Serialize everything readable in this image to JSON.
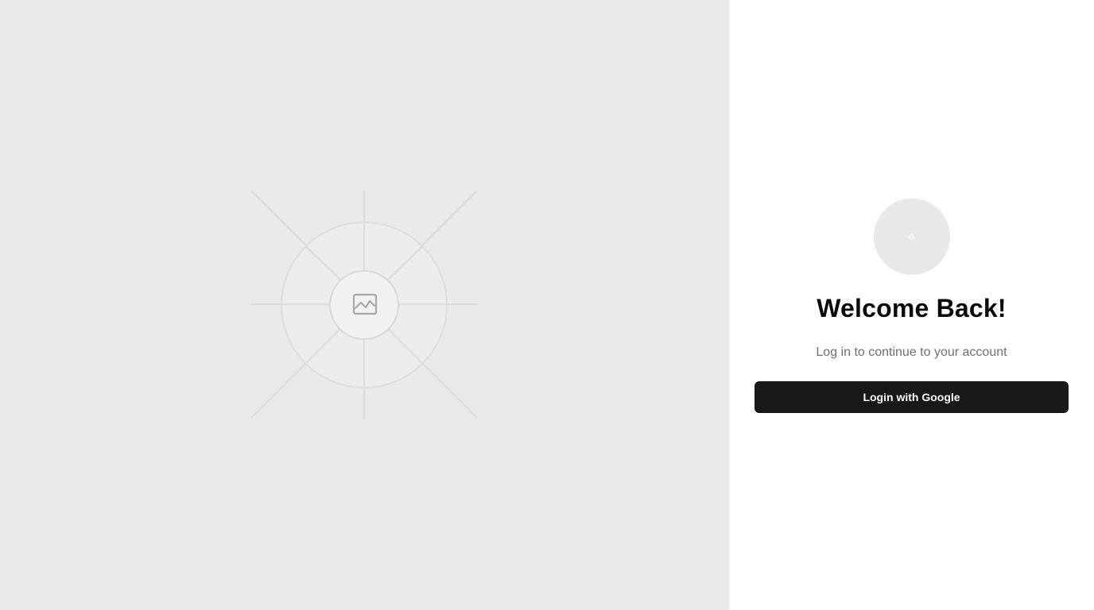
{
  "hero": {
    "illustration": "image-placeholder-icon"
  },
  "auth": {
    "logo": "logo-placeholder-icon",
    "title": "Welcome Back!",
    "subtitle": "Log in to continue to your account",
    "login_button_label": "Login with Google"
  },
  "colors": {
    "hero_background": "#e9e9e9",
    "button_background": "#18181b",
    "button_text": "#fafafa",
    "title_text": "#0a0a0a",
    "subtitle_text": "#6f6f74"
  }
}
